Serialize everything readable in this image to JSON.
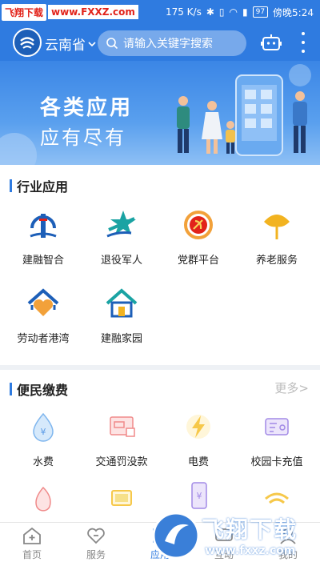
{
  "status_bar": {
    "watermark_badge": "飞翔下载",
    "watermark_url": "www.FXXZ.com",
    "network_speed": "175 K/s",
    "battery": "97",
    "time": "傍晚5:24"
  },
  "header": {
    "province": "云南省",
    "search_placeholder": "请输入关键字搜索"
  },
  "banner": {
    "line1": "各类应用",
    "line2": "应有尽有"
  },
  "industry": {
    "title": "行业应用",
    "apps": [
      {
        "label": "建融智合",
        "icon": "lighthouse-icon"
      },
      {
        "label": "退役军人",
        "icon": "star-icon"
      },
      {
        "label": "党群平台",
        "icon": "party-emblem-icon"
      },
      {
        "label": "养老服务",
        "icon": "ginkgo-leaf-icon"
      },
      {
        "label": "劳动者港湾",
        "icon": "heart-house-icon"
      },
      {
        "label": "建融家园",
        "icon": "home-icon"
      }
    ]
  },
  "payment": {
    "title": "便民缴费",
    "more": "更多>",
    "apps": [
      {
        "label": "水费",
        "icon": "water-drop-icon"
      },
      {
        "label": "交通罚没款",
        "icon": "traffic-fine-icon"
      },
      {
        "label": "电费",
        "icon": "lightning-icon"
      },
      {
        "label": "校园卡充值",
        "icon": "campus-card-icon"
      }
    ],
    "partial_icons": [
      "gas-flame-icon",
      "tv-icon",
      "phone-bill-icon",
      "wifi-icon"
    ]
  },
  "bottom_nav": [
    {
      "label": "首页",
      "icon": "home-plus-icon",
      "active": false
    },
    {
      "label": "服务",
      "icon": "heart-chat-icon",
      "active": false
    },
    {
      "label": "应用",
      "icon": "apps-icon",
      "active": true
    },
    {
      "label": "互动",
      "icon": "interaction-icon",
      "active": false
    },
    {
      "label": "我的",
      "icon": "profile-icon",
      "active": false
    }
  ],
  "overlay_watermark": {
    "title": "飞翔下载",
    "url": "www.fxxz.com"
  },
  "colors": {
    "brand": "#2f7be0",
    "accent_red": "#e2231a"
  }
}
